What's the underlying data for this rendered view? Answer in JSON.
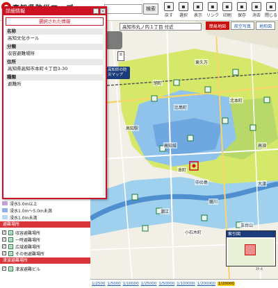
{
  "header": {
    "title": "高知県防災マップ",
    "search_button": "検索",
    "tools": [
      {
        "icon": "refresh-icon",
        "label": "戻す"
      },
      {
        "icon": "select-icon",
        "label": "選択"
      },
      {
        "icon": "grid-icon",
        "label": "表示"
      },
      {
        "icon": "link-icon",
        "label": "リンク"
      },
      {
        "icon": "print-icon",
        "label": "印刷"
      },
      {
        "icon": "save-icon",
        "label": "保存"
      },
      {
        "icon": "clear-icon",
        "label": "消去"
      },
      {
        "icon": "logout-icon",
        "label": "閉じる"
      }
    ]
  },
  "map": {
    "address": "高知市丸ノ内１丁目 付近",
    "tabs": [
      "簡易地図",
      "航空写真",
      "地形図"
    ],
    "link_box": "高知県の防災マップ",
    "minimap_title": "索引図",
    "north_label": "ｽｹｰﾙ",
    "place_labels": [
      "鏡川",
      "高知駅",
      "本町",
      "高知城",
      "中の島",
      "小石木町",
      "高須",
      "北本町",
      "比島町",
      "東久万",
      "旭町",
      "潮江",
      "大津",
      "五台山"
    ],
    "scales": [
      "1/2500",
      "1/5000",
      "1/10000",
      "1/25000",
      "1/50000",
      "1/100000",
      "1/200000",
      "1/20000"
    ],
    "active_scale_index": 7
  },
  "legend": {
    "rows": [
      {
        "color": "#c4a0d8",
        "label": "浸水5.0m以上"
      },
      {
        "color": "#8fb0e8",
        "label": "浸水1.0m～5.0m未満"
      },
      {
        "color": "#b8d8f0",
        "label": "浸水1.0m未満"
      }
    ],
    "categories": [
      {
        "title": "避難場所",
        "items": [
          "収容避難場所",
          "一時避難場所",
          "広域避難場所",
          "その他避難場所"
        ]
      },
      {
        "title": "津波避難場所",
        "items": [
          "津波避難ビル"
        ]
      }
    ]
  },
  "popup": {
    "title": "詳細情報",
    "subtitle": "選択された情報",
    "fields": [
      {
        "label": "名称",
        "value": "高知文化ホール"
      },
      {
        "label": "分類",
        "value": "収容避難場所"
      },
      {
        "label": "住所",
        "value": "高知県高知市本町４丁目3-30"
      },
      {
        "label": "種類",
        "value": "避難所"
      }
    ]
  },
  "colors": {
    "accent": "#c12",
    "flood": "#6fa8e0",
    "land": "#d6e86a"
  }
}
